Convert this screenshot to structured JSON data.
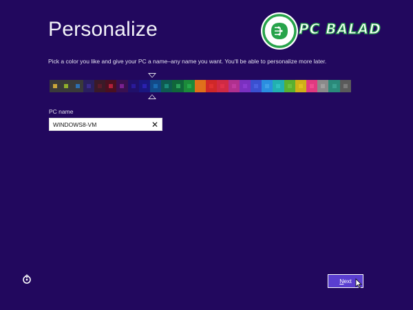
{
  "header": {
    "title": "Personalize",
    "description": "Pick a color you like and give your PC a name–any name you want. You'll be able to personalize more later."
  },
  "color_picker": {
    "selected_index": 6,
    "colors": [
      "#c9a63a",
      "#8fae2c",
      "#2d6fb0",
      "#3a2a8a",
      "#5a1a2a",
      "#b0203a",
      "#7a2090",
      "#2a1a9a",
      "#2a20b0",
      "#1a6ab0",
      "#1a8a7a",
      "#2aa05a",
      "#25a84a",
      "#e07020",
      "#e03030",
      "#e0304a",
      "#c03aa0",
      "#8a3ad0",
      "#4a60e0",
      "#40a0e8",
      "#30c0c0",
      "#6ac040",
      "#e0c020",
      "#f04a90",
      "#a0a0a0",
      "#3aa090",
      "#7a7a7a"
    ],
    "cell_backgrounds": [
      "#3a3a3a",
      "#3a3a3a",
      "#3a3a3a",
      "#2a1f5e",
      "#3a1a28",
      "#4a1020",
      "#3a1050",
      "#20106a",
      "#1a1680",
      "#124a88",
      "#0e5a50",
      "#10663a",
      "#1c8a3a",
      "#e0701a",
      "#d02828",
      "#d02a44",
      "#b0308e",
      "#7a30c0",
      "#3a50d0",
      "#2a8ee0",
      "#22b0b0",
      "#5ab030",
      "#d0b018",
      "#e03a80",
      "#8a8a8a",
      "#2a8a7a",
      "#5a5a5a"
    ]
  },
  "pc_name": {
    "label": "PC name",
    "value": "WINDOWS8-VM",
    "clear_glyph": "✕"
  },
  "footer": {
    "next_label_underlined": "N",
    "next_label_rest": "ext",
    "ease_of_access_icon": "ease-of-access-icon"
  },
  "watermark": {
    "text": "PC BALAD",
    "color_green": "#27a34a"
  }
}
